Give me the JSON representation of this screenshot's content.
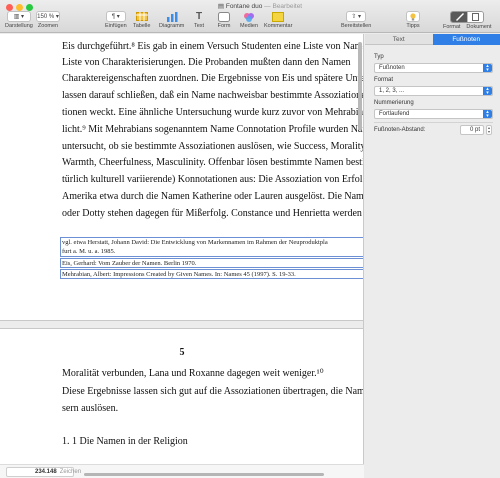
{
  "window": {
    "title": "Fontane duo",
    "title_sep": "—",
    "subtitle": "Bearbeitet",
    "traffic_lights": [
      "#ff5f57",
      "#ffbd2e",
      "#28c940"
    ]
  },
  "toolbar": {
    "view": {
      "label": "Darstellung"
    },
    "zoom": {
      "label": "Zoomen",
      "value": "150 %"
    },
    "insert": {
      "label": "Einfügen",
      "icon": "paragraph-icon"
    },
    "table": {
      "label": "Tabelle"
    },
    "chart": {
      "label": "Diagramm"
    },
    "text": {
      "label": "Text"
    },
    "shape": {
      "label": "Form"
    },
    "media": {
      "label": "Medien"
    },
    "comment": {
      "label": "Kommentar"
    },
    "share": {
      "label": "Bereitstellen"
    },
    "tips": {
      "label": "Tipps"
    },
    "format": {
      "label": "Format"
    },
    "document": {
      "label": "Dokument"
    }
  },
  "document": {
    "lines": [
      "Eis durchgeführt.⁸  Eis gab in einem Versuch Studenten eine Liste von Namen",
      "Liste von Charakterisierungen. Die Probanden mußten dann den Namen",
      "Charaktereigenschaften zuordnen. Die Ergebnisse von Eis und spätere Unters",
      "lassen darauf schließen, daß ein Name nachweisbar bestimmte Assoziationen",
      "tionen weckt. Eine ähnliche Untersuchung wurde kurz zuvor von Mehrabian",
      "licht.⁹  Mit Mehrabians sogenanntem Name Connotation Profile wurden Nam",
      "untersucht, ob sie  bestimmte Assoziationen auslösen, wie Success, Morality, I",
      "Warmth, Cheerfulness, Masculinity. Offenbar lösen bestimmte Namen besti",
      "türlich kulturell variierende) Konnotationen aus: Die Assoziation von Erfol",
      "Amerika etwa durch die Namen Katherine oder Lauren ausgelöst. Die Nam",
      "oder Dotty stehen dagegen für Mißerfolg. Constance und Henrietta werden of"
    ],
    "footnotes": [
      "vgl. etwa  Herstatt, Johann David: Die Entwicklung von Markennamen im Rahmen der Neuproduktpla",
      "furt a. M. u. a. 1985.",
      "Eis, Gerhard: Vom Zauber der Namen. Berlin 1970.",
      "Mehrabian, Albert: Impressions Created by Given Names. In: Names 45 (1997). S. 19-33."
    ],
    "page_number": "5",
    "page2_lines": [
      "Moralität verbunden, Lana und Roxanne dagegen weit weniger.¹⁰",
      "Diese Ergebnisse lassen sich gut auf die Assoziationen übertragen, die Nam",
      "sern auslösen."
    ],
    "heading": "1. 1 Die Namen in der Religion"
  },
  "status": {
    "word_count": "234.148",
    "word_count_label": "Zeichen"
  },
  "sidebar": {
    "tabs": [
      "Text",
      "Fußnoten"
    ],
    "active_tab": "Fußnoten",
    "type_label": "Typ",
    "type_value": "Fußnoten",
    "format_label": "Format",
    "format_value": "1, 2, 3, ...",
    "numbering_label": "Nummerierung",
    "numbering_value": "Fortlaufend",
    "spacing_label": "Fußnoten-Abstand:",
    "spacing_value": "0 pt"
  }
}
